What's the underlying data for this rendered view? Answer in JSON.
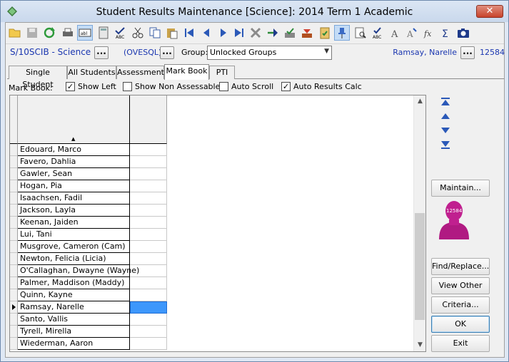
{
  "window": {
    "title": "Student Results Maintenance  [Science]:  2014 Term 1 Academic",
    "close_label": "✕"
  },
  "toolbar": {
    "buttons": [
      "open-folder-icon",
      "save-icon",
      "refresh-icon",
      "print-icon",
      "text-field-icon",
      "calculator-icon",
      "spell-check-icon",
      "cut-icon",
      "copy-icon",
      "paste-icon",
      "first-record-icon",
      "previous-record-icon",
      "next-record-icon",
      "last-record-icon",
      "delete-icon",
      "go-icon",
      "approve-icon",
      "import-icon",
      "clipboard-check-icon",
      "pin-icon",
      "preview-icon",
      "spelling-icon",
      "font-icon",
      "formula-a-icon",
      "function-icon",
      "sum-icon",
      "camera-icon"
    ]
  },
  "selector": {
    "class_code": "S/10SCIB - Science",
    "server": "(OVESQL)",
    "group_label": "Group:",
    "group_value": "Unlocked Groups",
    "teacher": "Ramsay, Narelle",
    "teacher_id": "12584",
    "dots_label": "..."
  },
  "tabs": [
    {
      "label": "Single Student",
      "selected": false
    },
    {
      "label": "All Students",
      "selected": false
    },
    {
      "label": "Assessment",
      "selected": false
    },
    {
      "label": "Mark Book",
      "selected": true
    },
    {
      "label": "PTI",
      "selected": false
    }
  ],
  "options": {
    "label": "Mark Book:",
    "show_left": {
      "label": "Show Left",
      "checked": true
    },
    "show_non_assessable": {
      "label": "Show Non Assessable",
      "checked": false
    },
    "auto_scroll": {
      "label": "Auto Scroll",
      "checked": false
    },
    "auto_results_calc": {
      "label": "Auto Results Calc",
      "checked": true
    }
  },
  "grid": {
    "sort_indicator": "▲",
    "students": [
      {
        "name": "Edouard, Marco",
        "current": false
      },
      {
        "name": "Favero, Dahlia",
        "current": false
      },
      {
        "name": "Gawler, Sean",
        "current": false
      },
      {
        "name": "Hogan, Pia",
        "current": false
      },
      {
        "name": "Isaachsen, Fadil",
        "current": false
      },
      {
        "name": "Jackson, Layla",
        "current": false
      },
      {
        "name": "Keenan, Jaiden",
        "current": false
      },
      {
        "name": "Lui, Tani",
        "current": false
      },
      {
        "name": "Musgrove, Cameron (Cam)",
        "current": false
      },
      {
        "name": "Newton, Felicia (Licia)",
        "current": false
      },
      {
        "name": "O'Callaghan, Dwayne (Wayne)",
        "current": false
      },
      {
        "name": "Palmer, Maddison (Maddy)",
        "current": false
      },
      {
        "name": "Quinn, Kayne",
        "current": false
      },
      {
        "name": "Ramsay, Narelle",
        "current": true
      },
      {
        "name": "Santo, Vallis",
        "current": false
      },
      {
        "name": "Tyrell, Mirella",
        "current": false
      },
      {
        "name": "Wiederman, Aaron",
        "current": false
      }
    ]
  },
  "side_panel": {
    "maintain": "Maintain...",
    "avatar_id": "12584",
    "find_replace": "Find/Replace...",
    "view_other": "View Other",
    "criteria": "Criteria...",
    "ok": "OK",
    "exit": "Exit"
  },
  "colors": {
    "selection": "#3d97fb",
    "link_text": "#1a36b0",
    "avatar": "#c0208f"
  }
}
